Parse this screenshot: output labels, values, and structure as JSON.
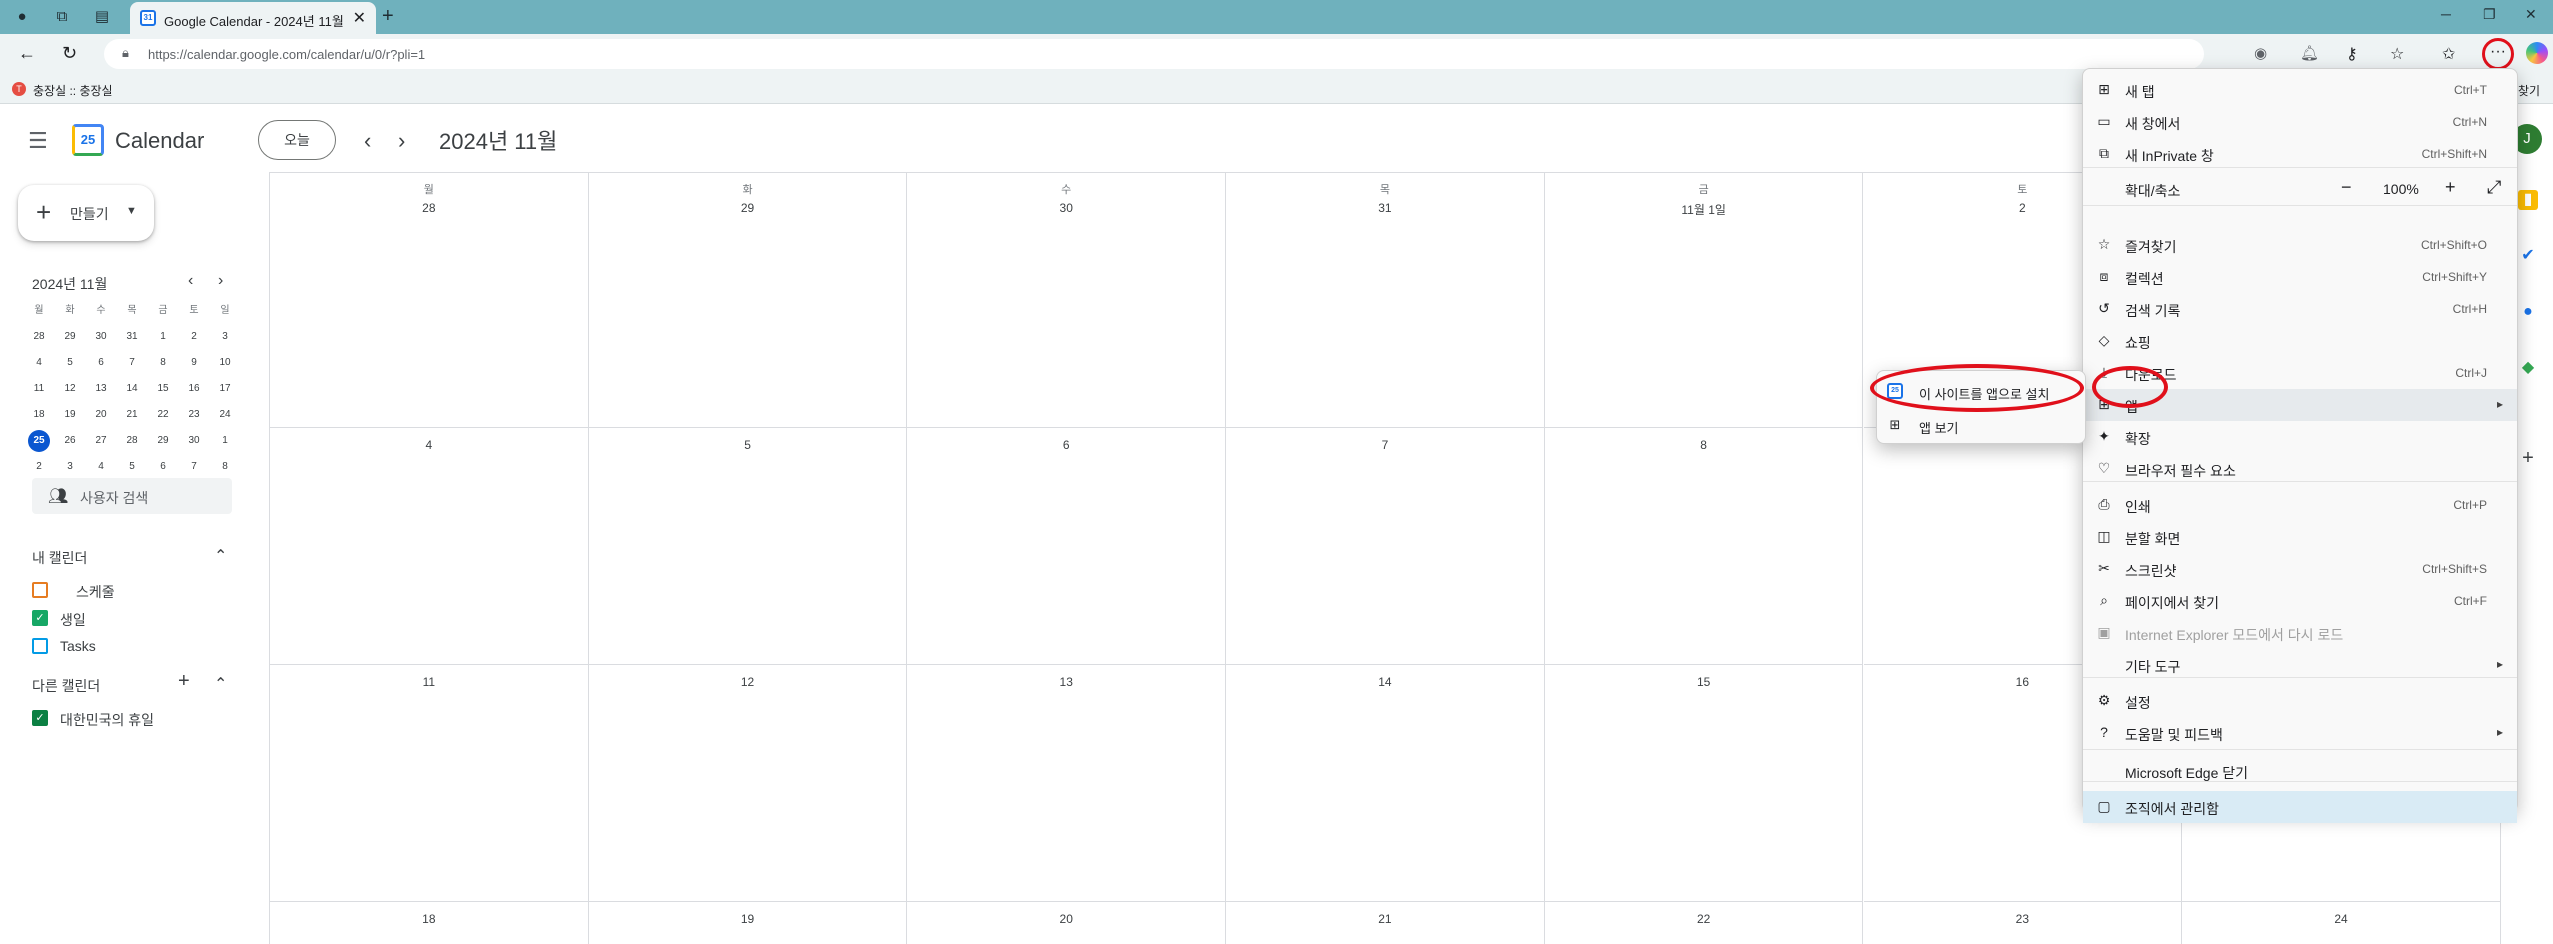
{
  "browser": {
    "tab_title": "Google Calendar - 2024년 11월",
    "tab_favicon": "31",
    "url": "https://calendar.google.com/calendar/u/0/r?pli=1",
    "favorite": {
      "label": "충장실 :: 충장실",
      "icon_text": "T"
    },
    "favorites_right": "찾기"
  },
  "calendar": {
    "app_title": "Calendar",
    "logo_text": "25",
    "today_label": "오늘",
    "month_title": "2024년 11월",
    "avatar": "J",
    "create_label": "만들기",
    "mini": {
      "title": "2024년 11월",
      "weekdays": [
        "월",
        "화",
        "수",
        "목",
        "금",
        "토",
        "일"
      ],
      "weeks": [
        [
          "28",
          "29",
          "30",
          "31",
          "1",
          "2",
          "3"
        ],
        [
          "4",
          "5",
          "6",
          "7",
          "8",
          "9",
          "10"
        ],
        [
          "11",
          "12",
          "13",
          "14",
          "15",
          "16",
          "17"
        ],
        [
          "18",
          "19",
          "20",
          "21",
          "22",
          "23",
          "24"
        ],
        [
          "25",
          "26",
          "27",
          "28",
          "29",
          "30",
          "1"
        ],
        [
          "2",
          "3",
          "4",
          "5",
          "6",
          "7",
          "8"
        ]
      ]
    },
    "people_search": "사용자 검색",
    "my_calendars": {
      "title": "내 캘린더",
      "items": [
        {
          "label": "스케줄",
          "color": "#e67c22",
          "checked": false
        },
        {
          "label": "생일",
          "color": "#16a765",
          "checked": true
        },
        {
          "label": "Tasks",
          "color": "#039be5",
          "checked": false
        }
      ]
    },
    "other_calendars": {
      "title": "다른 캘린더",
      "items": [
        {
          "label": "대한민국의 휴일",
          "color": "#0b8043",
          "checked": true
        }
      ]
    },
    "grid": {
      "weekdays": [
        "월",
        "화",
        "수",
        "목",
        "금",
        "토"
      ],
      "weeks": [
        [
          "28",
          "29",
          "30",
          "31",
          "11월 1일",
          "2"
        ],
        [
          "4",
          "5",
          "6",
          "7",
          "8",
          ""
        ],
        [
          "11",
          "12",
          "13",
          "14",
          "15",
          "16"
        ],
        [
          "18",
          "19",
          "20",
          "21",
          "22",
          "23"
        ]
      ],
      "sunday_last": "24"
    }
  },
  "edge_menu": {
    "items": [
      {
        "label": "새 탭",
        "shortcut": "Ctrl+T",
        "icon": "new-tab-icon",
        "glyph": "⊞"
      },
      {
        "label": "새 창에서",
        "shortcut": "Ctrl+N",
        "icon": "new-window-icon",
        "glyph": "▭"
      },
      {
        "label": "새 InPrivate 창",
        "shortcut": "Ctrl+Shift+N",
        "icon": "inprivate-icon",
        "glyph": "⧉"
      },
      {
        "label": "확대/축소",
        "shortcut": "",
        "icon": "",
        "glyph": ""
      },
      {
        "label": "즐겨찾기",
        "shortcut": "Ctrl+Shift+O",
        "icon": "favorites-icon",
        "glyph": "☆"
      },
      {
        "label": "컬렉션",
        "shortcut": "Ctrl+Shift+Y",
        "icon": "collections-icon",
        "glyph": "⧈"
      },
      {
        "label": "검색 기록",
        "shortcut": "Ctrl+H",
        "icon": "history-icon",
        "glyph": "↺"
      },
      {
        "label": "쇼핑",
        "shortcut": "",
        "icon": "shopping-icon",
        "glyph": "◇"
      },
      {
        "label": "다운로드",
        "shortcut": "Ctrl+J",
        "icon": "download-icon",
        "glyph": "⤓"
      },
      {
        "label": "앱",
        "shortcut": "",
        "icon": "apps-icon",
        "glyph": "⊞"
      },
      {
        "label": "확장",
        "shortcut": "",
        "icon": "extensions-icon",
        "glyph": "✦"
      },
      {
        "label": "브라우저 필수 요소",
        "shortcut": "",
        "icon": "browser-essentials-icon",
        "glyph": "♡"
      },
      {
        "label": "인쇄",
        "shortcut": "Ctrl+P",
        "icon": "print-icon",
        "glyph": "⎙"
      },
      {
        "label": "분할 화면",
        "shortcut": "",
        "icon": "split-screen-icon",
        "glyph": "◫"
      },
      {
        "label": "스크린샷",
        "shortcut": "Ctrl+Shift+S",
        "icon": "screenshot-icon",
        "glyph": "✂"
      },
      {
        "label": "페이지에서 찾기",
        "shortcut": "Ctrl+F",
        "icon": "find-icon",
        "glyph": "⌕"
      },
      {
        "label": "Internet Explorer 모드에서 다시 로드",
        "shortcut": "",
        "icon": "ie-mode-icon",
        "glyph": "▣"
      },
      {
        "label": "기타 도구",
        "shortcut": "",
        "icon": "",
        "glyph": ""
      },
      {
        "label": "설정",
        "shortcut": "",
        "icon": "settings-icon",
        "glyph": "⚙"
      },
      {
        "label": "도움말 및 피드백",
        "shortcut": "",
        "icon": "help-icon",
        "glyph": "?"
      },
      {
        "label": "Microsoft Edge 닫기",
        "shortcut": "",
        "icon": "",
        "glyph": ""
      },
      {
        "label": "조직에서 관리함",
        "shortcut": "",
        "icon": "managed-icon",
        "glyph": "▢"
      }
    ],
    "zoom_value": "100%",
    "submenu": {
      "install": "이 사이트를 앱으로 설치",
      "view": "앱 보기"
    }
  },
  "colors": {
    "tabbar": "#6fb1bd",
    "accent": "#1a73e8",
    "annotation_ring": "#e0101b"
  }
}
